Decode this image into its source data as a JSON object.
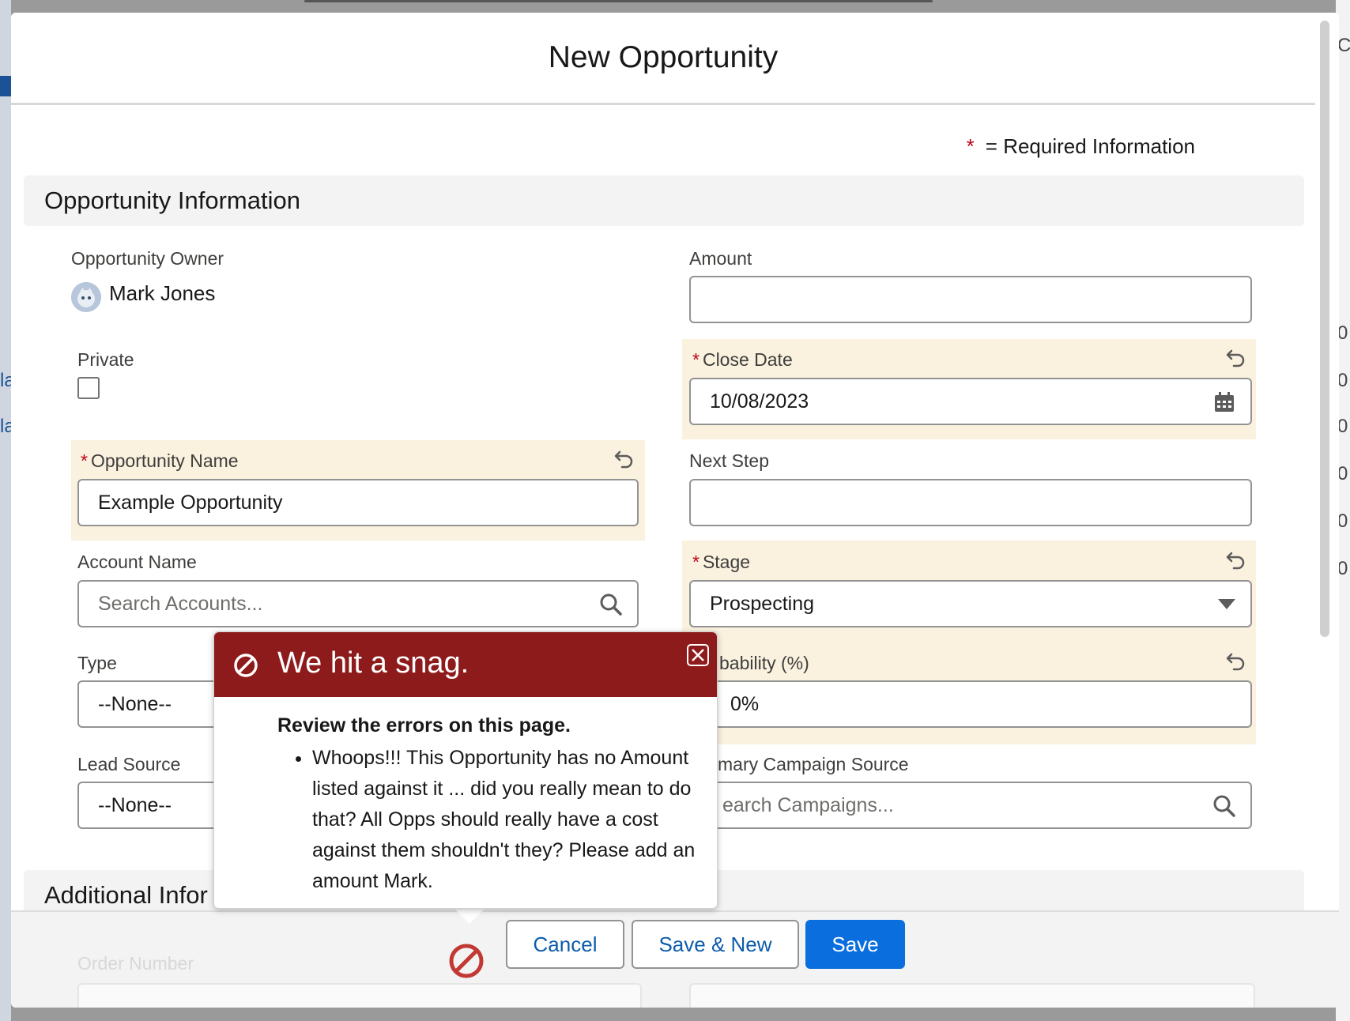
{
  "modal": {
    "title": "New Opportunity",
    "required_legend_star": "*",
    "required_legend_text": "= Required Information"
  },
  "sections": {
    "opportunity_information": "Opportunity Information",
    "additional_information": "Additional Infor"
  },
  "fields": {
    "owner": {
      "label": "Opportunity Owner",
      "value": "Mark Jones"
    },
    "private": {
      "label": "Private",
      "checked": false
    },
    "opportunity_name": {
      "star": "*",
      "label": "Opportunity Name",
      "value": "Example Opportunity"
    },
    "account_name": {
      "label": "Account Name",
      "placeholder": "Search Accounts..."
    },
    "type": {
      "label": "Type",
      "value": "--None--"
    },
    "lead_source": {
      "label": "Lead Source",
      "value": "--None--"
    },
    "amount": {
      "label": "Amount",
      "value": ""
    },
    "close_date": {
      "star": "*",
      "label": "Close Date",
      "value": "10/08/2023"
    },
    "next_step": {
      "label": "Next Step",
      "value": ""
    },
    "stage": {
      "star": "*",
      "label": "Stage",
      "value": "Prospecting"
    },
    "probability": {
      "label": "bability (%)",
      "value": "0%"
    },
    "campaign": {
      "label": "mary Campaign Source",
      "placeholder": "earch Campaigns..."
    },
    "order_number": {
      "label": "Order Number"
    }
  },
  "error_popover": {
    "title": "We hit a snag.",
    "heading": "Review the errors on this page.",
    "errors": [
      "Whoops!!! This Opportunity has no Amount listed against it ... did you really mean to do that? All Opps should really have a cost against them shouldn't they? Please add an amount Mark."
    ]
  },
  "footer": {
    "cancel_label": "Cancel",
    "save_new_label": "Save & New",
    "save_label": "Save"
  },
  "background": {
    "right_fragments": [
      "C",
      "0",
      "0",
      "0",
      "0",
      "0",
      "0"
    ],
    "left_fragments": [
      "la",
      "la"
    ]
  },
  "colors": {
    "brand": "#0b6edf",
    "error_header": "#8e1b1b",
    "required_star": "#ba0517",
    "changed_field_bg": "#faf1df"
  }
}
